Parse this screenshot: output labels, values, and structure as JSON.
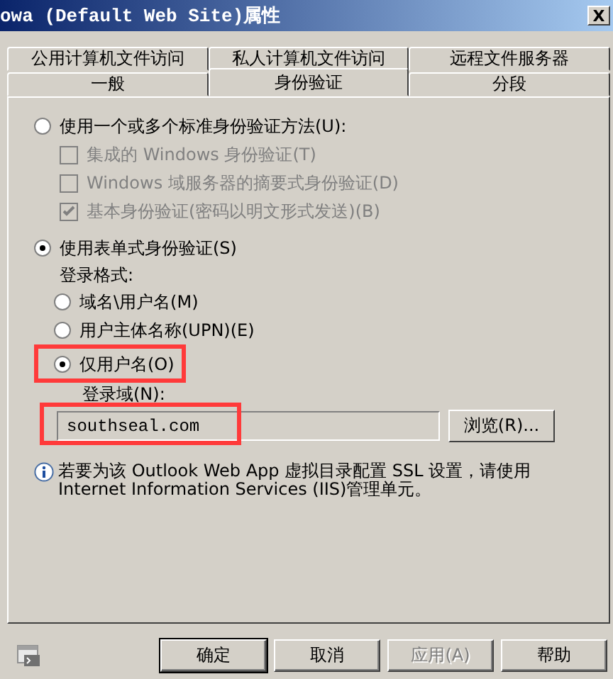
{
  "window": {
    "title": "owa (Default Web Site)属性",
    "close_label": "X"
  },
  "tab_rows": [
    [
      {
        "label": "公用计算机文件访问",
        "selected": false
      },
      {
        "label": "私人计算机文件访问",
        "selected": false
      },
      {
        "label": "远程文件服务器",
        "selected": false
      }
    ],
    [
      {
        "label": "一般",
        "selected": false
      },
      {
        "label": "身份验证",
        "selected": true
      },
      {
        "label": "分段",
        "selected": false
      }
    ]
  ],
  "methods": [
    {
      "label": "使用一个或多个标准身份验证方法(U):",
      "selected": false,
      "children": [
        {
          "label": "集成的 Windows 身份验证(T)",
          "checked": false,
          "disabled": true
        },
        {
          "label": "Windows 域服务器的摘要式身份验证(D)",
          "checked": false,
          "disabled": true
        },
        {
          "label": "基本身份验证(密码以明文形式发送)(B)",
          "checked": true,
          "disabled": true
        }
      ]
    },
    {
      "label": "使用表单式身份验证(S)",
      "selected": true
    }
  ],
  "logon_format": {
    "label": "登录格式:",
    "options": [
      {
        "label": "域名\\用户名(M)",
        "selected": false,
        "highlighted": false
      },
      {
        "label": "用户主体名称(UPN)(E)",
        "selected": false,
        "highlighted": false
      },
      {
        "label": "仅用户名(O)",
        "selected": true,
        "highlighted": true
      }
    ]
  },
  "logon_domain": {
    "label": "登录域(N):",
    "value": "southseal.com",
    "highlighted": true,
    "browse_button": "浏览(R)..."
  },
  "info": "若要为该 Outlook Web App 虚拟目录配置 SSL 设置，请使用 Internet Information Services (IIS)管理单元。",
  "buttons": [
    {
      "label": "确定",
      "default": true,
      "disabled": false
    },
    {
      "label": "取消",
      "default": false,
      "disabled": false
    },
    {
      "label": "应用(A)",
      "default": false,
      "disabled": true
    },
    {
      "label": "帮助",
      "default": false,
      "disabled": false
    }
  ]
}
